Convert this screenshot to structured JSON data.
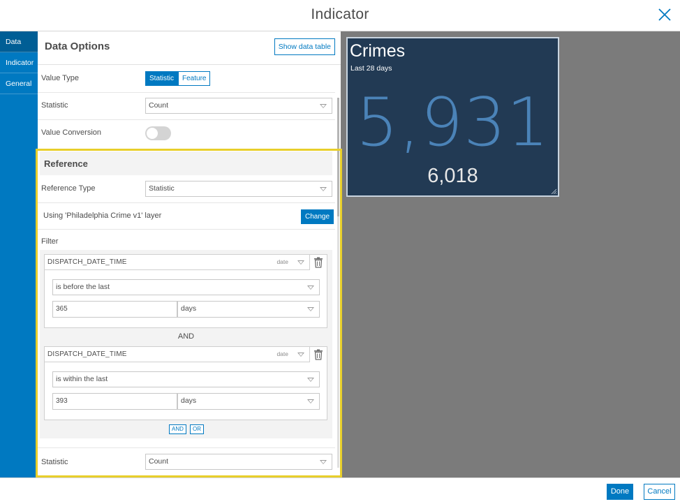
{
  "dialog": {
    "title": "Indicator"
  },
  "tabs": [
    {
      "label": "Data",
      "active": true
    },
    {
      "label": "Indicator",
      "active": false
    },
    {
      "label": "General",
      "active": false
    }
  ],
  "data_options": {
    "heading": "Data Options",
    "show_data_table_label": "Show data table",
    "value_type": {
      "label": "Value Type",
      "options": [
        "Statistic",
        "Feature"
      ],
      "selected": "Statistic"
    },
    "statistic": {
      "label": "Statistic",
      "value": "Count"
    },
    "value_conversion": {
      "label": "Value Conversion",
      "enabled": false
    }
  },
  "reference": {
    "heading": "Reference",
    "reference_type": {
      "label": "Reference Type",
      "value": "Statistic"
    },
    "layer_text": "Using 'Philadelphia Crime v1' layer",
    "change_label": "Change",
    "filter_label": "Filter",
    "filters": [
      {
        "field": "DISPATCH_DATE_TIME",
        "type": "date",
        "operator": "is before the last",
        "amount": "365",
        "unit": "days"
      },
      {
        "field": "DISPATCH_DATE_TIME",
        "type": "date",
        "operator": "is within the last",
        "amount": "393",
        "unit": "days"
      }
    ],
    "join_label": "AND",
    "add_and_label": "AND",
    "add_or_label": "OR",
    "statistic": {
      "label": "Statistic",
      "value": "Count"
    }
  },
  "preview": {
    "title": "Crimes",
    "subtitle": "Last 28 days",
    "value": "5,931",
    "reference_value": "6,018",
    "background": "#223a54",
    "value_color": "#4b83b8"
  },
  "footer": {
    "done_label": "Done",
    "cancel_label": "Cancel"
  },
  "colors": {
    "accent": "#0079c1",
    "highlight": "#e8cf2b"
  }
}
